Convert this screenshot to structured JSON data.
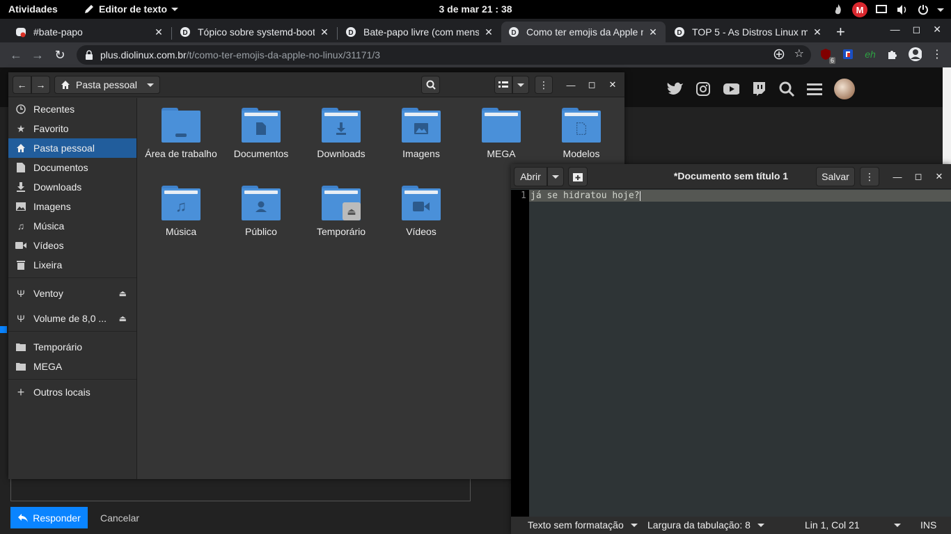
{
  "topbar": {
    "activities": "Atividades",
    "app_name": "Editor de texto",
    "clock": "3 de mar  21 : 38",
    "mega_letter": "M"
  },
  "browser": {
    "tabs": [
      {
        "title": "#bate-papo",
        "favicon": "discord-icon"
      },
      {
        "title": "Tópico sobre systemd-boot",
        "favicon": "diolinux-icon"
      },
      {
        "title": "Bate-papo livre (com mens",
        "favicon": "diolinux-icon"
      },
      {
        "title": "Como ter emojis da Apple n",
        "favicon": "diolinux-icon",
        "active": true
      },
      {
        "title": "TOP 5 - As Distros Linux m",
        "favicon": "diolinux-icon"
      }
    ],
    "url_host": "plus.diolinux.com.br",
    "url_path": "/t/como-ter-emojis-da-apple-no-linux/31171/3",
    "ext_badge": "6",
    "ext_eh": "eh"
  },
  "webpage": {
    "reply_button": "Responder",
    "cancel_button": "Cancelar"
  },
  "files": {
    "location": "Pasta pessoal",
    "sidebar": [
      {
        "label": "Recentes",
        "icon": "clock-icon"
      },
      {
        "label": "Favorito",
        "icon": "star-icon"
      },
      {
        "label": "Pasta pessoal",
        "icon": "home-icon",
        "selected": true
      },
      {
        "label": "Documentos",
        "icon": "document-icon"
      },
      {
        "label": "Downloads",
        "icon": "download-icon"
      },
      {
        "label": "Imagens",
        "icon": "image-icon"
      },
      {
        "label": "Música",
        "icon": "music-icon"
      },
      {
        "label": "Vídeos",
        "icon": "video-icon"
      },
      {
        "label": "Lixeira",
        "icon": "trash-icon"
      },
      {
        "label": "Ventoy",
        "icon": "usb-icon"
      },
      {
        "label": "Volume de 8,0 ...",
        "icon": "usb-icon"
      },
      {
        "label": "Temporário",
        "icon": "folder-icon"
      },
      {
        "label": "MEGA",
        "icon": "folder-icon"
      },
      {
        "label": "Outros locais",
        "icon": "plus-icon"
      }
    ],
    "folders": [
      {
        "name": "Área de trabalho",
        "glyph": "desktop"
      },
      {
        "name": "Documentos",
        "glyph": "document"
      },
      {
        "name": "Downloads",
        "glyph": "download"
      },
      {
        "name": "Imagens",
        "glyph": "image"
      },
      {
        "name": "MEGA",
        "glyph": "none"
      },
      {
        "name": "Modelos",
        "glyph": "template"
      },
      {
        "name": "Música",
        "glyph": "music"
      },
      {
        "name": "Público",
        "glyph": "user"
      },
      {
        "name": "Temporário",
        "glyph": "drive"
      },
      {
        "name": "Vídeos",
        "glyph": "video"
      }
    ]
  },
  "gedit": {
    "open_button": "Abrir",
    "save_button": "Salvar",
    "title": "*Documento sem título 1",
    "line_number": "1",
    "text": "já se hidratou hoje?",
    "status_format": "Texto sem formatação",
    "status_tab": "Largura da tabulação: 8",
    "status_pos": "Lin 1, Col 21",
    "status_mode": "INS"
  }
}
